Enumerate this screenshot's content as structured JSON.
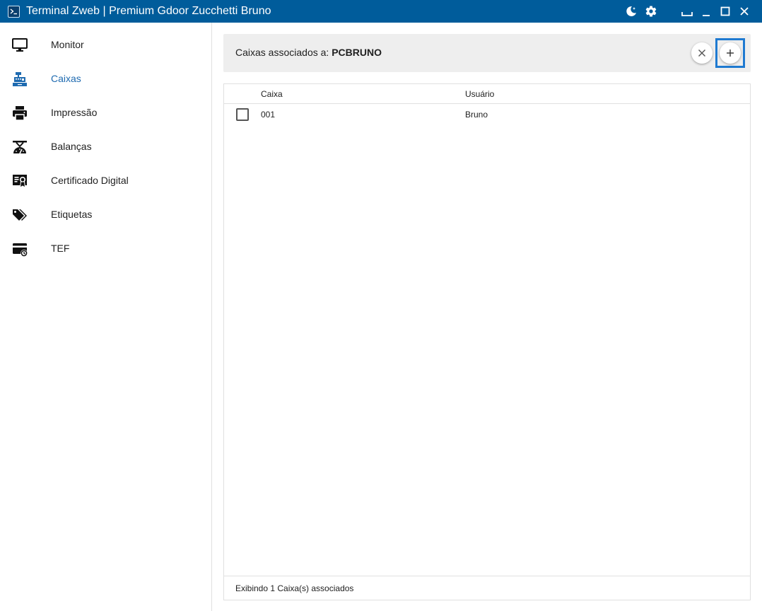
{
  "window": {
    "title": "Terminal Zweb | Premium Gdoor Zucchetti Bruno",
    "accent_color": "#005c9b",
    "controls": [
      "theme-toggle-icon",
      "gear-icon",
      "minimize-to-tray-icon",
      "minimize-icon",
      "maximize-icon",
      "close-icon"
    ]
  },
  "sidebar": {
    "active_color": "#1e6ab0",
    "items": [
      {
        "label": "Monitor",
        "icon": "monitor-icon"
      },
      {
        "label": "Caixas",
        "icon": "cash-register-icon"
      },
      {
        "label": "Impressão",
        "icon": "printer-icon"
      },
      {
        "label": "Balanças",
        "icon": "scale-icon"
      },
      {
        "label": "Certificado Digital",
        "icon": "certificate-icon"
      },
      {
        "label": "Etiquetas",
        "icon": "tags-icon"
      },
      {
        "label": "TEF",
        "icon": "card-terminal-icon"
      }
    ],
    "active_index": 1
  },
  "header": {
    "label": "Caixas associados a:",
    "machine": "PCBRUNO"
  },
  "table": {
    "columns": [
      "Caixa",
      "Usuário"
    ],
    "rows": [
      {
        "caixa": "001",
        "usuario": "Bruno",
        "checked": false
      }
    ],
    "footer": "Exibindo 1 Caixa(s) associados"
  }
}
